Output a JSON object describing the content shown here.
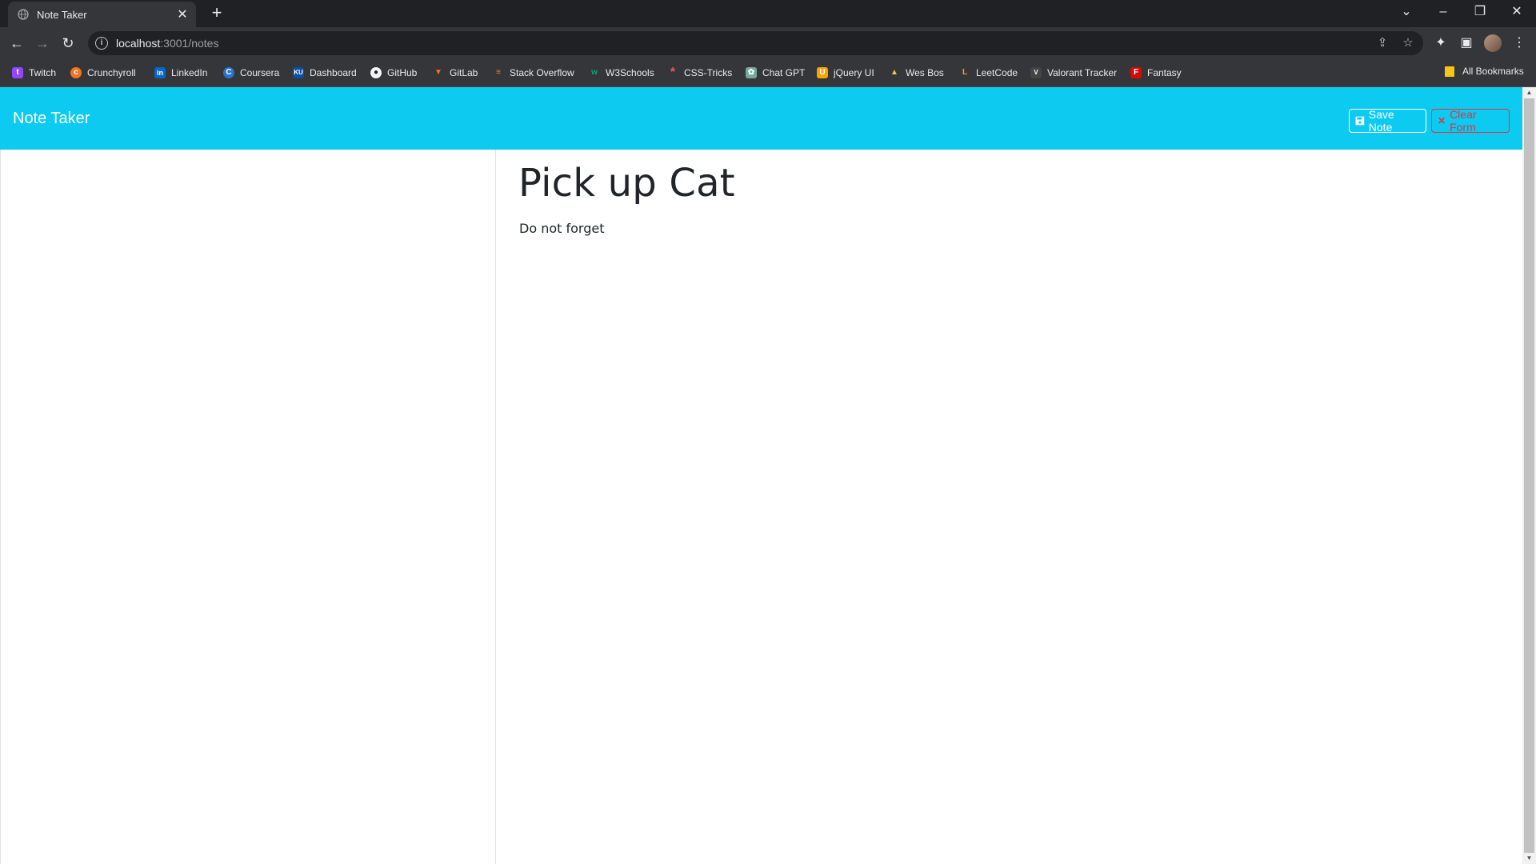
{
  "browser": {
    "tab_title": "Note Taker",
    "tab_close": "✕",
    "new_tab": "+",
    "url_host": "localhost",
    "url_path": ":3001/notes",
    "bookmarks": [
      {
        "label": "Twitch",
        "color": "#9146ff",
        "glyph": "t"
      },
      {
        "label": "Crunchyroll",
        "color": "#f47521",
        "glyph": "c"
      },
      {
        "label": "LinkedIn",
        "color": "#0a66c2",
        "glyph": "in"
      },
      {
        "label": "Coursera",
        "color": "#2a73cc",
        "glyph": "C"
      },
      {
        "label": "Dashboard",
        "color": "#0b4ea2",
        "glyph": "KU"
      },
      {
        "label": "GitHub",
        "color": "#202124",
        "glyph": "●"
      },
      {
        "label": "GitLab",
        "color": "#fc6d26",
        "glyph": "▼"
      },
      {
        "label": "Stack Overflow",
        "color": "#f48024",
        "glyph": "≡"
      },
      {
        "label": "W3Schools",
        "color": "#04aa6d",
        "glyph": "w"
      },
      {
        "label": "CSS-Tricks",
        "color": "#e2575f",
        "glyph": "*"
      },
      {
        "label": "Chat GPT",
        "color": "#74aa9c",
        "glyph": "✿"
      },
      {
        "label": "jQuery UI",
        "color": "#f8a500",
        "glyph": "U"
      },
      {
        "label": "Wes Bos",
        "color": "#202124",
        "glyph": "▲"
      },
      {
        "label": "LeetCode",
        "color": "#ffa116",
        "glyph": "L"
      },
      {
        "label": "Valorant Tracker",
        "color": "#444444",
        "glyph": "V"
      },
      {
        "label": "Fantasy",
        "color": "#d50a0a",
        "glyph": "F"
      }
    ],
    "all_bookmarks": "All Bookmarks"
  },
  "app": {
    "brand": "Note Taker",
    "save_label": "Save Note",
    "clear_label": "Clear Form",
    "colors": {
      "navbar": "#0dcaf0",
      "danger": "#dc3545"
    }
  },
  "note": {
    "title": "Pick up Cat",
    "text": "Do not forget"
  }
}
